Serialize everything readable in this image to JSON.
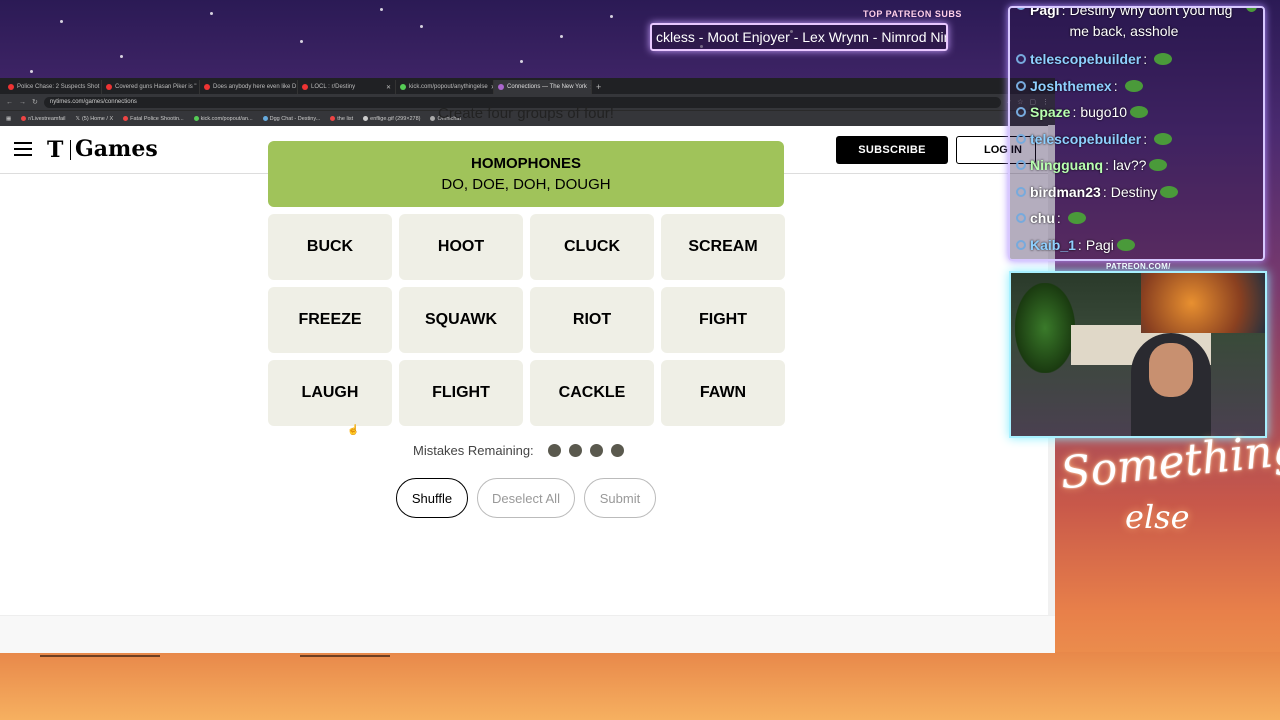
{
  "overlay": {
    "patreon_label": "TOP PATREON SUBS",
    "patreon_scroller": "ckless - Moot Enjoyer - Lex Wrynn - Nimrod Nir",
    "patreon_url": "PATREON.COM/",
    "signature_line1": "Something",
    "signature_line2": "else"
  },
  "browser": {
    "tabs": [
      {
        "label": "Police Chase: 2 Suspects Shot"
      },
      {
        "label": "Covered guns Hasan Piker is \""
      },
      {
        "label": "Does anybody here even like D"
      },
      {
        "label": "LOCL : r/Destiny"
      },
      {
        "label": "kick.com/popout/anythingelse"
      },
      {
        "label": "Connections — The New York"
      }
    ],
    "new_tab": "+",
    "url": "nytimes.com/games/connections",
    "bookmarks": [
      "r/Livestreamfail",
      "(5) Home / X",
      "Fatal Police Shootin...",
      "kick.com/popout/an...",
      "Dgg Chat - Destiny...",
      "the list",
      "enflige.gif (299×278)",
      "Omnichat"
    ]
  },
  "nyt": {
    "logo_mark": "T",
    "logo_text": "Games",
    "subscribe": "SUBSCRIBE",
    "login": "LOG IN"
  },
  "game": {
    "instructions": "Create four groups of four!",
    "solved": {
      "title": "HOMOPHONES",
      "words": "DO, DOE, DOH, DOUGH",
      "color": "#a0c35a"
    },
    "cards": [
      "BUCK",
      "HOOT",
      "CLUCK",
      "SCREAM",
      "FREEZE",
      "SQUAWK",
      "RIOT",
      "FIGHT",
      "LAUGH",
      "FLIGHT",
      "CACKLE",
      "FAWN"
    ],
    "mistakes_label": "Mistakes Remaining:",
    "mistakes_remaining": 4,
    "buttons": {
      "shuffle": "Shuffle",
      "deselect": "Deselect All",
      "submit": "Submit"
    }
  },
  "chat": {
    "messages": [
      {
        "user": "Pagi",
        "text": "Destiny why don't you hug me back, asshole"
      },
      {
        "user": "telescopebuilder",
        "text": ""
      },
      {
        "user": "Joshthemex",
        "text": ""
      },
      {
        "user": "Spaze",
        "text": "bugo10"
      },
      {
        "user": "telescopebuilder",
        "text": ""
      },
      {
        "user": "Ningguanq",
        "text": "lav??"
      },
      {
        "user": "birdman23",
        "text": "Destiny"
      },
      {
        "user": "chu",
        "text": ""
      },
      {
        "user": "Kaib_1",
        "text": "Pagi"
      }
    ],
    "user_colors": [
      "#ffffff",
      "#8fd0ff",
      "#8fd0ff",
      "#b8ffb0",
      "#8fd0ff",
      "#b8ffb0",
      "#ffffff",
      "#ffffff",
      "#8fd0ff"
    ]
  }
}
